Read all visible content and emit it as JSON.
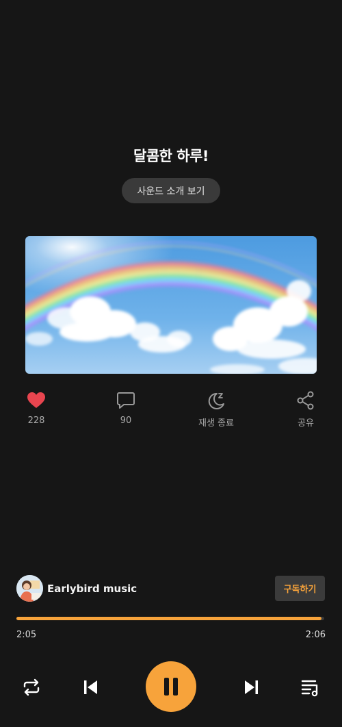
{
  "track": {
    "title": "달콤한 하루!",
    "sound_intro_label": "사운드 소개 보기"
  },
  "actions": {
    "like_count": "228",
    "comment_count": "90",
    "sleep_timer_label": "재생 종료",
    "share_label": "공유"
  },
  "artist": {
    "name": "Earlybird music",
    "subscribe_label": "구독하기"
  },
  "player": {
    "current_time": "2:05",
    "total_time": "2:06",
    "progress": 0.992
  },
  "colors": {
    "accent": "#f7a33b",
    "like": "#e8454f",
    "background": "#161616"
  },
  "icons": {
    "like": "heart-icon",
    "comment": "speech-bubble-icon",
    "sleep": "moon-icon",
    "share": "share-icon",
    "repeat": "repeat-icon",
    "previous": "skip-previous-icon",
    "pause": "pause-icon",
    "next": "skip-next-icon",
    "playlist": "playlist-icon"
  }
}
